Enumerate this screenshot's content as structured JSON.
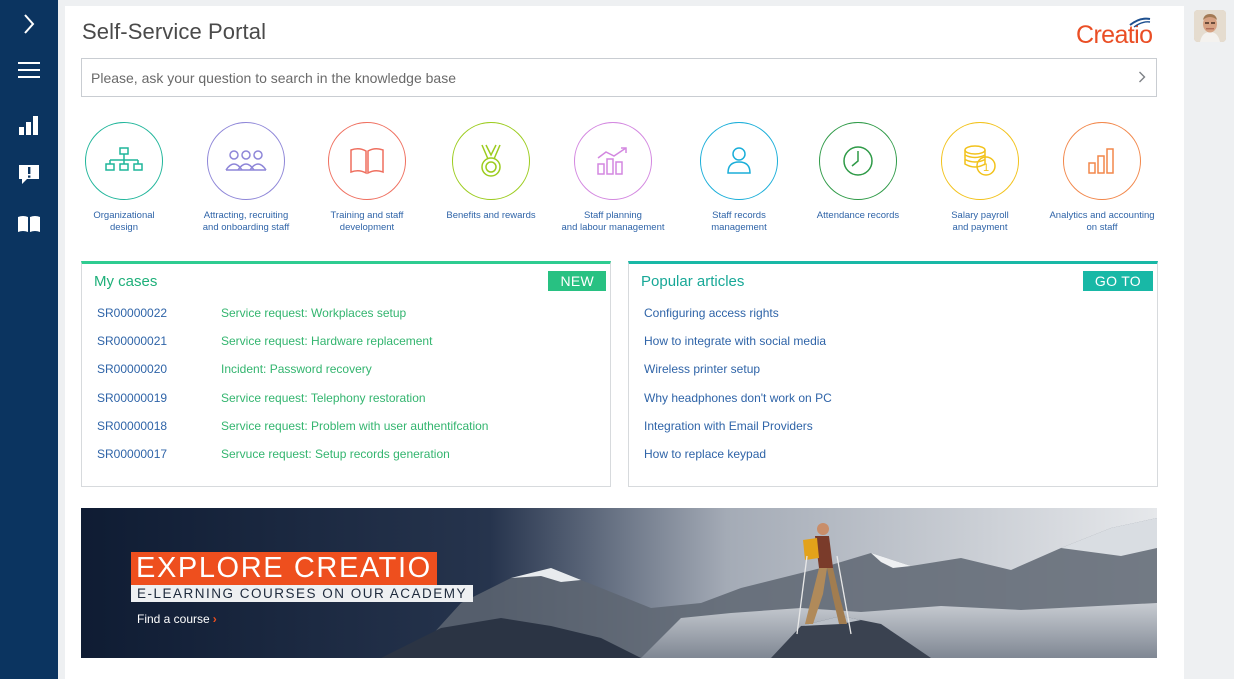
{
  "app": {
    "title": "Self-Service Portal",
    "brand": "Creatio",
    "brand_color": "#ea4e25",
    "nav_color": "#0b3460"
  },
  "nav": {
    "items": [
      {
        "icon": "chevron-right-icon"
      },
      {
        "icon": "hamburger-menu-icon"
      },
      {
        "icon": "bar-chart-icon"
      },
      {
        "icon": "feedback-icon"
      },
      {
        "icon": "open-book-icon"
      }
    ]
  },
  "search": {
    "placeholder": "Please, ask your question to search in the knowledge base",
    "icon": "chevron-right-icon"
  },
  "categories": [
    {
      "label": "Organizational\ndesign",
      "icon": "org-chart-icon",
      "color": "#1fb59a"
    },
    {
      "label": "Attracting, recruiting\nand onboarding staff",
      "icon": "people-group-icon",
      "color": "#8e86d8"
    },
    {
      "label": "Training and staff\ndevelopment",
      "icon": "open-book-icon",
      "color": "#ef6f5f"
    },
    {
      "label": "Benefits and rewards",
      "icon": "medal-icon",
      "color": "#9ccc1e"
    },
    {
      "label": "Staff planning\nand labour management",
      "icon": "growth-chart-icon",
      "color": "#d387e0"
    },
    {
      "label": "Staff records\nmanagement",
      "icon": "person-icon",
      "color": "#1aaed9"
    },
    {
      "label": "Attendance records",
      "icon": "clock-icon",
      "color": "#2e9a47"
    },
    {
      "label": "Salary payroll\nand payment",
      "icon": "coins-icon",
      "color": "#f2c21b"
    },
    {
      "label": "Analytics and accounting\non staff",
      "icon": "bar-chart-icon",
      "color": "#f2874a"
    }
  ],
  "my_cases": {
    "title": "My cases",
    "button": "NEW",
    "rows": [
      {
        "number": "SR00000022",
        "subject": "Service request: Workplaces setup"
      },
      {
        "number": "SR00000021",
        "subject": "Service request: Hardware replacement"
      },
      {
        "number": "SR00000020",
        "subject": "Incident: Password recovery"
      },
      {
        "number": "SR00000019",
        "subject": "Service request: Telephony restoration"
      },
      {
        "number": "SR00000018",
        "subject": "Service request: Problem with user authentifcation"
      },
      {
        "number": "SR00000017",
        "subject": "Servuce request: Setup records generation"
      }
    ]
  },
  "popular_articles": {
    "title": "Popular articles",
    "button": "GO TO",
    "items": [
      "Configuring access rights",
      "How to integrate with social media",
      "Wireless printer setup",
      "Why headphones don't work on PC",
      "Integration with Email Providers",
      "How to replace keypad"
    ]
  },
  "banner": {
    "headline": "EXPLORE CREATIO",
    "subheadline": "E-LEARNING COURSES ON OUR ACADEMY",
    "link": "Find a course",
    "link_icon": "chevron-right-icon"
  },
  "user": {
    "avatar": "user-avatar"
  }
}
